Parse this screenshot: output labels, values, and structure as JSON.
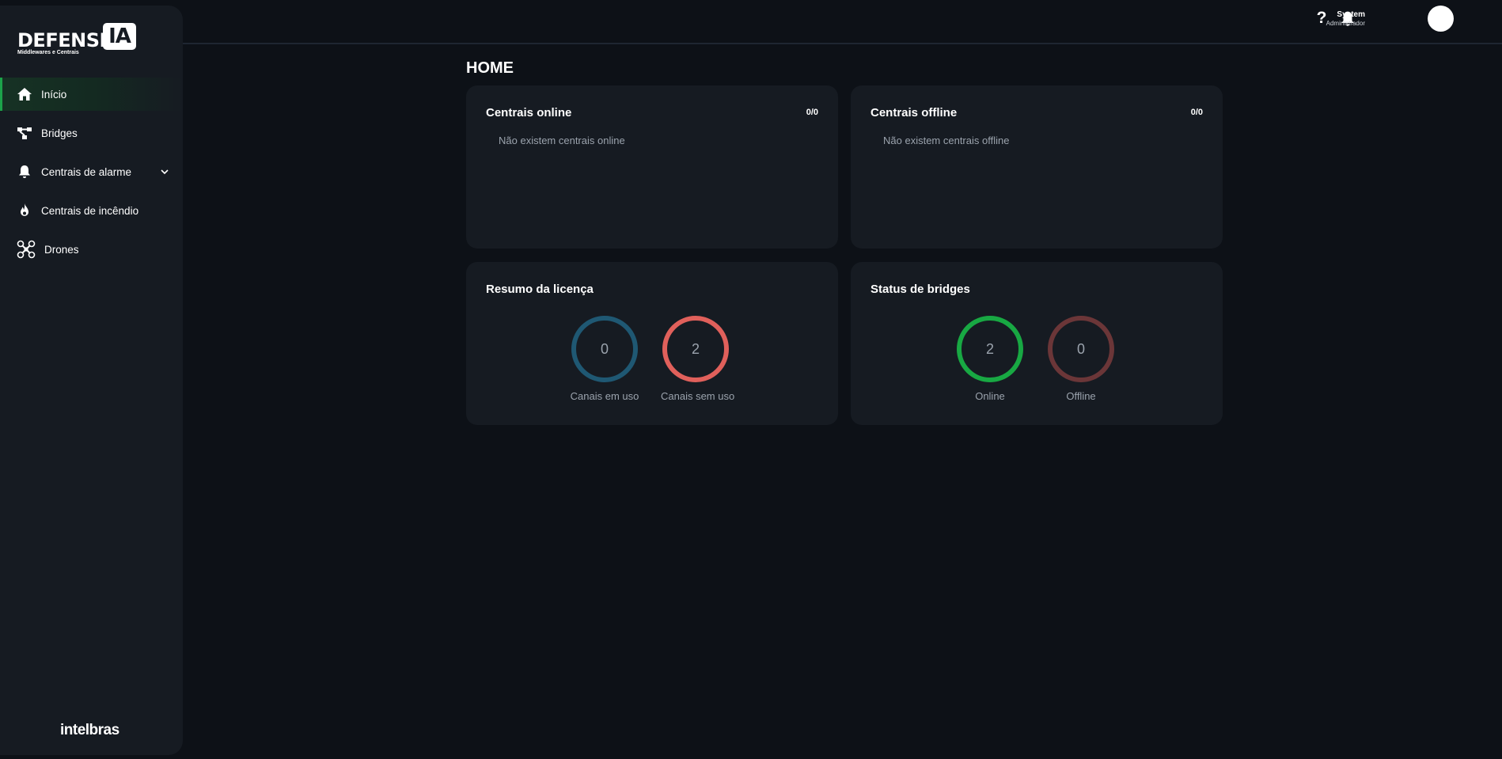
{
  "app": {
    "logo_word": "DEFENSE",
    "logo_box": "IA",
    "logo_subtitle": "Middlewares e Centrais",
    "brand_footer": "intelbras"
  },
  "sidebar": {
    "items": [
      {
        "label": "Início",
        "icon": "home-icon",
        "active": true
      },
      {
        "label": "Bridges",
        "icon": "bridge-icon"
      },
      {
        "label": "Centrais de alarme",
        "icon": "bell-icon",
        "expandable": true
      },
      {
        "label": "Centrais de incêndio",
        "icon": "flame-icon"
      },
      {
        "label": "Drones",
        "icon": "drone-icon"
      }
    ]
  },
  "header": {
    "help_glyph": "?",
    "user_name": "System",
    "user_role": "Administrador"
  },
  "page": {
    "title": "HOME"
  },
  "cards": {
    "online": {
      "title": "Centrais online",
      "count": "0/0",
      "empty": "Não existem centrais online"
    },
    "offline": {
      "title": "Centrais offline",
      "count": "0/0",
      "empty": "Não existem centrais offline"
    },
    "license": {
      "title": "Resumo da licença",
      "rings": [
        {
          "value": "0",
          "label": "Canais em uso",
          "color": "#1f5873"
        },
        {
          "value": "2",
          "label": "Canais sem uso",
          "color": "#e0605b"
        }
      ]
    },
    "bridges": {
      "title": "Status de bridges",
      "rings": [
        {
          "value": "2",
          "label": "Online",
          "color": "#18a843"
        },
        {
          "value": "0",
          "label": "Offline",
          "color": "#6b3638"
        }
      ]
    }
  },
  "colors": {
    "background": "#0d1117",
    "panel": "#161b22",
    "accent": "#1ca34a"
  }
}
